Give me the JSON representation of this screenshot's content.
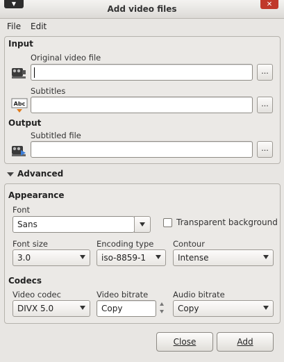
{
  "window": {
    "title": "Add video files",
    "menu_glyph": "▼",
    "close_glyph": "✕"
  },
  "menubar": {
    "file": "File",
    "edit": "Edit"
  },
  "input": {
    "heading": "Input",
    "original_label": "Original video file",
    "original_value": "",
    "subtitles_label": "Subtitles",
    "subtitles_value": ""
  },
  "output": {
    "heading": "Output",
    "subtitled_label": "Subtitled file",
    "subtitled_value": ""
  },
  "browse_label": "...",
  "subtitle_icon_text": "Abc",
  "advanced": {
    "label": "Advanced",
    "appearance": {
      "heading": "Appearance",
      "font_label": "Font",
      "font_value": "Sans",
      "transparent_label": "Transparent background",
      "transparent_checked": false,
      "font_size_label": "Font size",
      "font_size_value": "3.0",
      "encoding_label": "Encoding type",
      "encoding_value": "iso-8859-1",
      "contour_label": "Contour",
      "contour_value": "Intense"
    },
    "codecs": {
      "heading": "Codecs",
      "video_codec_label": "Video codec",
      "video_codec_value": "DIVX 5.0",
      "video_bitrate_label": "Video bitrate",
      "video_bitrate_value": "Copy",
      "audio_bitrate_label": "Audio bitrate",
      "audio_bitrate_value": "Copy"
    }
  },
  "buttons": {
    "close": "Close",
    "add": "Add"
  }
}
